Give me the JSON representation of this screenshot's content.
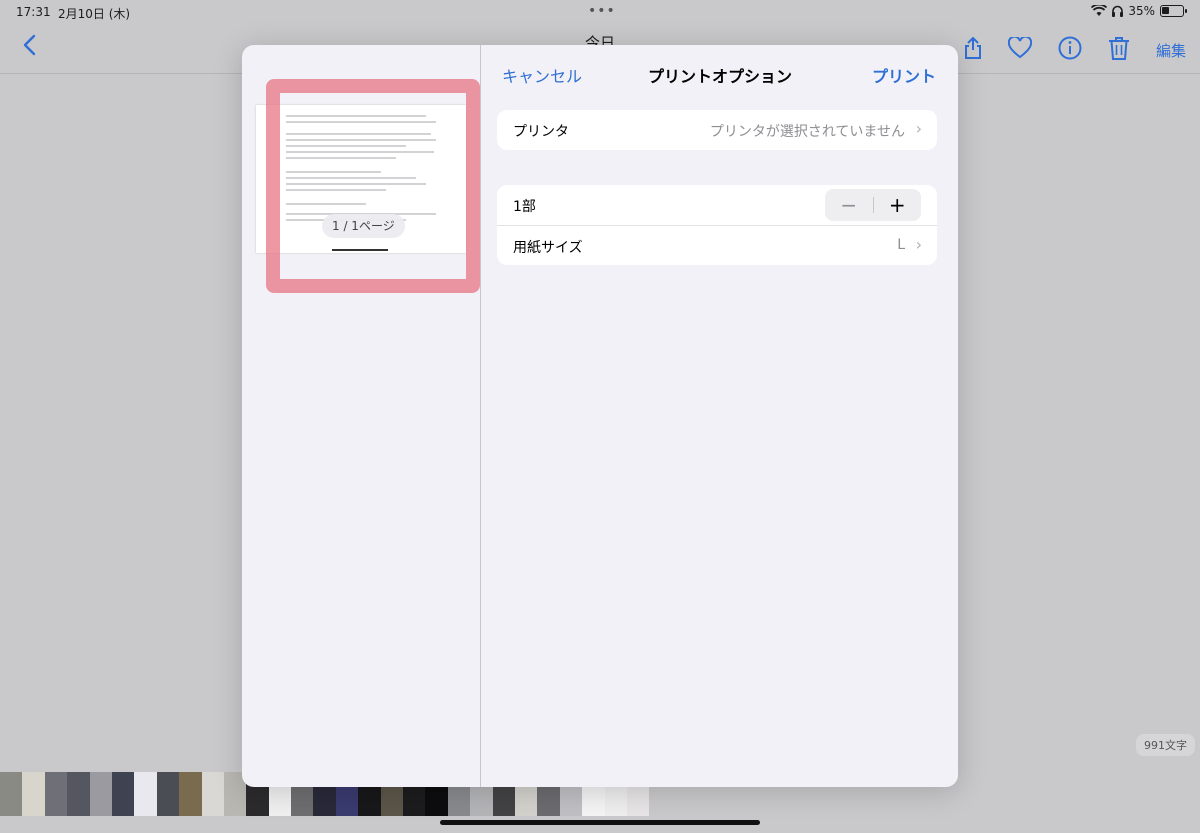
{
  "status_bar": {
    "time": "17:31",
    "date": "2月10日 (木)",
    "battery": "35%"
  },
  "nav": {
    "title": "今日",
    "edit_label": "編集"
  },
  "word_count": "991文字",
  "print_sheet": {
    "cancel_label": "キャンセル",
    "title": "プリントオプション",
    "print_label": "プリント",
    "page_indicator": "1 / 1ページ",
    "printer": {
      "label": "プリンタ",
      "value": "プリンタが選択されていません"
    },
    "copies": {
      "label": "1部"
    },
    "paper_size": {
      "label": "用紙サイズ",
      "value": "L"
    }
  },
  "colors": {
    "accent": "#2f6fd6",
    "sheet_bg": "#f2f1f7",
    "highlight": "#e87080"
  }
}
